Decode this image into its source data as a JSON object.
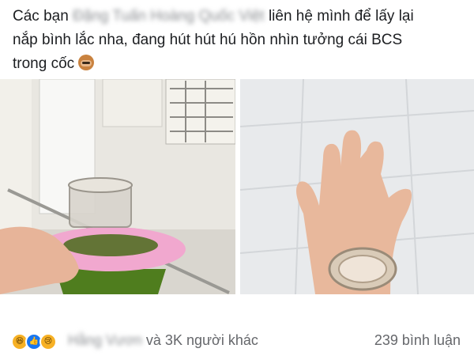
{
  "post": {
    "line1_start": "Các bạn",
    "blurred_name": "Đặng Tuấn Hoàng Quốc Việt",
    "line1_end": "liên hệ mình để lấy lại",
    "line2": "nắp bình lắc nha, đang hút hút hú hồn nhìn tưởng cái BCS",
    "line3": "trong cốc",
    "emoji": "see-no-evil-monkey-icon"
  },
  "reactions": {
    "icons": [
      "haha-icon",
      "like-icon",
      "sad-icon"
    ],
    "blurred_name": "Hằng Vươn",
    "others": "và 3K người khác",
    "comments": "239 bình luận"
  },
  "colors": {
    "like_blue": "#1877f2",
    "reaction_yellow": "#f7b125",
    "meta_gray": "#65676b"
  }
}
